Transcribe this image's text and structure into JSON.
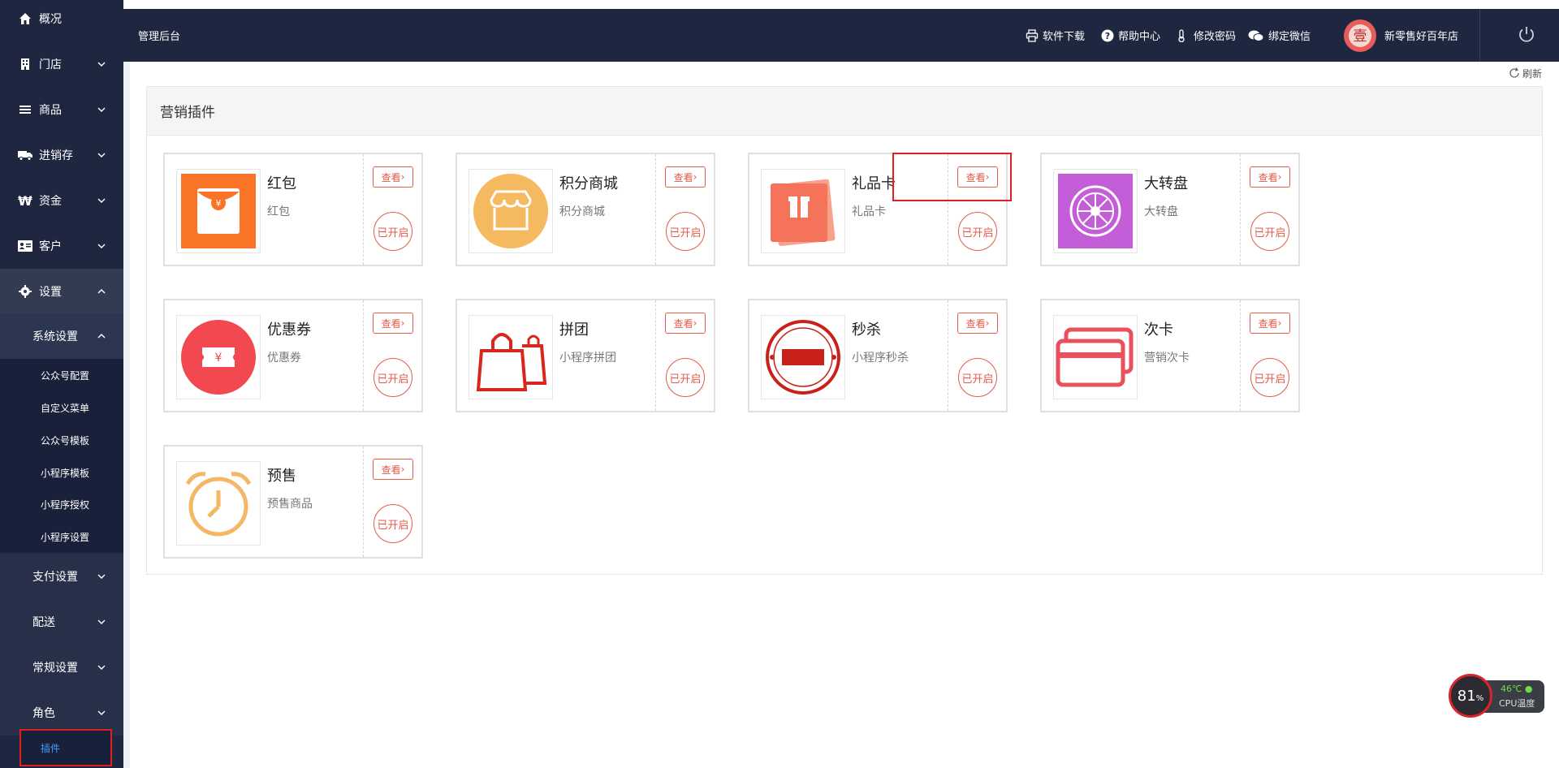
{
  "header": {
    "title": "管理后台",
    "links": [
      {
        "label": "软件下载",
        "icon": "printer-icon"
      },
      {
        "label": "帮助中心",
        "icon": "help-icon"
      },
      {
        "label": "修改密码",
        "icon": "thermometer-icon"
      },
      {
        "label": "绑定微信",
        "icon": "wechat-icon"
      }
    ],
    "store_name": "新零售好百年店"
  },
  "sidebar": {
    "items": [
      {
        "label": "概况",
        "icon": "home-icon"
      },
      {
        "label": "门店",
        "icon": "building-icon"
      },
      {
        "label": "商品",
        "icon": "list-icon"
      },
      {
        "label": "进销存",
        "icon": "truck-icon"
      },
      {
        "label": "资金",
        "icon": "won-icon"
      },
      {
        "label": "客户",
        "icon": "id-card-icon"
      },
      {
        "label": "设置",
        "icon": "gear-icon"
      }
    ],
    "system_settings": {
      "label": "系统设置",
      "children": [
        "公众号配置",
        "自定义菜单",
        "公众号模板",
        "小程序模板",
        "小程序授权",
        "小程序设置"
      ]
    },
    "more_sections": [
      "支付设置",
      "配送",
      "常规设置",
      "角色"
    ],
    "active_item": "插件"
  },
  "refresh_label": "刷新",
  "panel": {
    "title": "营销插件",
    "view_label": "查看",
    "open_label": "已开启",
    "plugins": [
      {
        "name": "红包",
        "desc": "红包",
        "icon": "red-envelope-icon"
      },
      {
        "name": "积分商城",
        "desc": "积分商城",
        "icon": "store-icon"
      },
      {
        "name": "礼品卡",
        "desc": "礼品卡",
        "icon": "gift-card-icon"
      },
      {
        "name": "大转盘",
        "desc": "大转盘",
        "icon": "wheel-icon"
      },
      {
        "name": "优惠券",
        "desc": "优惠券",
        "icon": "coupon-icon"
      },
      {
        "name": "拼团",
        "desc": "小程序拼团",
        "icon": "shopping-bag-icon"
      },
      {
        "name": "秒杀",
        "desc": "小程序秒杀",
        "icon": "flash-sale-icon"
      },
      {
        "name": "次卡",
        "desc": "营销次卡",
        "icon": "card-icon"
      },
      {
        "name": "预售",
        "desc": "预售商品",
        "icon": "alarm-clock-icon"
      }
    ]
  },
  "cpu_widget": {
    "usage": "81",
    "usage_unit": "%",
    "temperature": "46℃",
    "label": "CPU温度"
  }
}
